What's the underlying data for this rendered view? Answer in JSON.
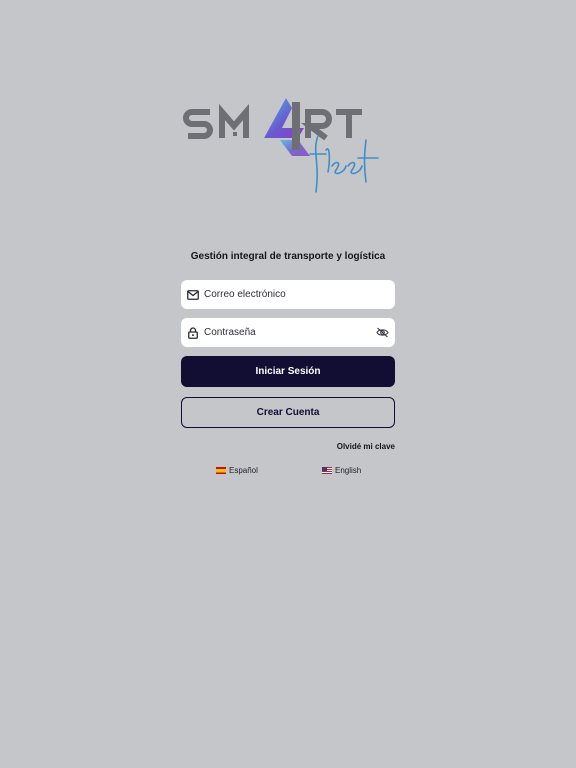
{
  "logo": {
    "text": "SM4RT fleet",
    "accent_colors": [
      "#7b5bd6",
      "#4bb8e0",
      "#6e6f74"
    ]
  },
  "tagline": "Gestión integral de transporte y logística",
  "email": {
    "placeholder": "Correo electrónico",
    "icon": "mail-icon"
  },
  "password": {
    "placeholder": "Contraseña",
    "icon": "lock-icon",
    "toggle_icon": "eye-off-icon"
  },
  "buttons": {
    "login": "Iniciar Sesión",
    "create_account": "Crear Cuenta"
  },
  "forgot": "Olvidé mi clave",
  "languages": [
    {
      "label": "Español",
      "flag": "spain-flag-icon"
    },
    {
      "label": "English",
      "flag": "us-flag-icon"
    }
  ],
  "colors": {
    "background": "#c5c6ca",
    "primary": "#120d33",
    "field": "#ffffff"
  }
}
